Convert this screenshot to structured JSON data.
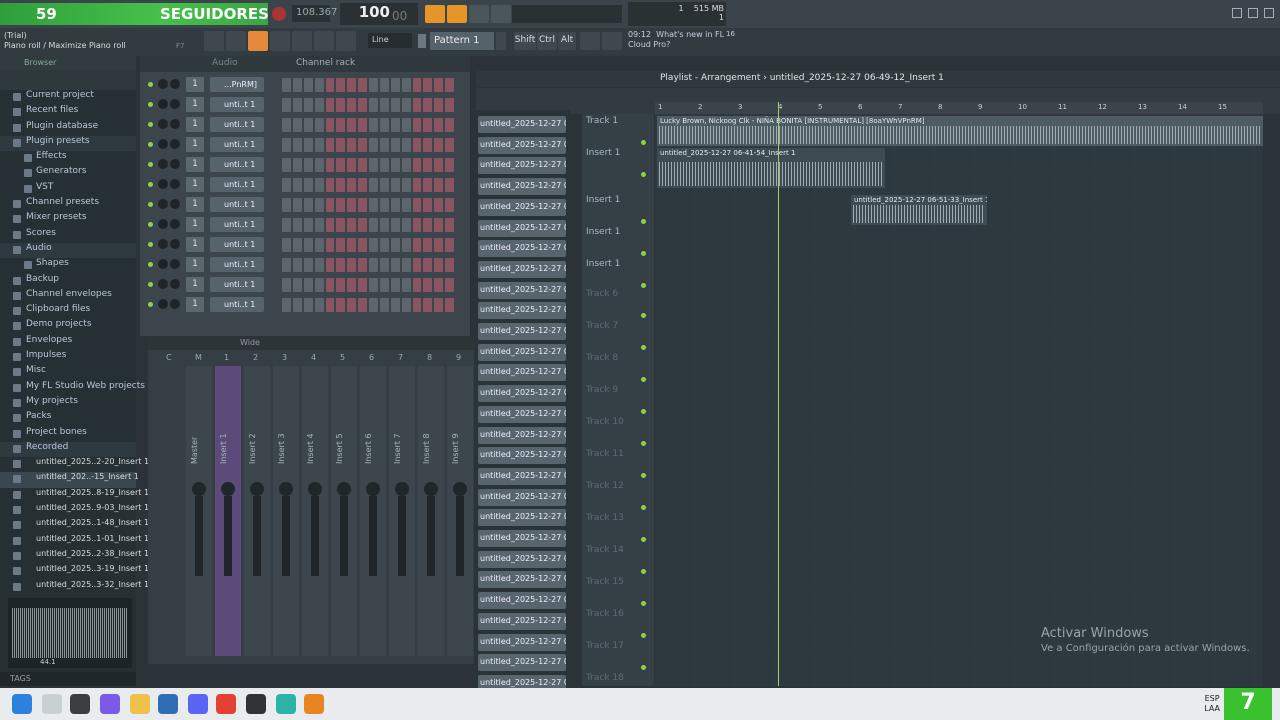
{
  "overlay": {
    "followers": "59",
    "label": "SEGUIDORES"
  },
  "transport": {
    "tempo_small": "108.367",
    "tempo": "100",
    "tempo_dec": "00",
    "memory": "515 MB",
    "cpu": "1",
    "voices": "1"
  },
  "hint": {
    "line1": "(Trial)",
    "line2": "Piano roll / Maximize Piano roll",
    "key": "F7"
  },
  "snap": "Line",
  "pattern": "Pattern 1",
  "keys": [
    "Shift",
    "Ctrl",
    "Alt"
  ],
  "news": {
    "time": "09:12",
    "line1": "What's new in FL",
    "line2": "Cloud Pro?",
    "count": "16"
  },
  "browser": {
    "title": "Browser",
    "items": [
      {
        "label": "Current project",
        "cls": ""
      },
      {
        "label": "Recent files",
        "cls": ""
      },
      {
        "label": "Plugin database",
        "cls": ""
      },
      {
        "label": "Plugin presets",
        "cls": "hl"
      },
      {
        "label": "Effects",
        "cls": "sub"
      },
      {
        "label": "Generators",
        "cls": "sub"
      },
      {
        "label": "VST",
        "cls": "sub"
      },
      {
        "label": "Channel presets",
        "cls": ""
      },
      {
        "label": "Mixer presets",
        "cls": ""
      },
      {
        "label": "Scores",
        "cls": ""
      },
      {
        "label": "Audio",
        "cls": "hl"
      },
      {
        "label": "Shapes",
        "cls": "sub"
      },
      {
        "label": "Backup",
        "cls": ""
      },
      {
        "label": "Channel envelopes",
        "cls": ""
      },
      {
        "label": "Clipboard files",
        "cls": ""
      },
      {
        "label": "Demo projects",
        "cls": ""
      },
      {
        "label": "Envelopes",
        "cls": ""
      },
      {
        "label": "Impulses",
        "cls": ""
      },
      {
        "label": "Misc",
        "cls": ""
      },
      {
        "label": "My FL Studio Web projects",
        "cls": ""
      },
      {
        "label": "My projects",
        "cls": ""
      },
      {
        "label": "Packs",
        "cls": ""
      },
      {
        "label": "Project bones",
        "cls": ""
      },
      {
        "label": "Recorded",
        "cls": "hl"
      },
      {
        "label": "untitled_2025..2-20_Insert 1",
        "cls": "rec"
      },
      {
        "label": "untitled_202..-15_Insert 1",
        "cls": "rec sel"
      },
      {
        "label": "untitled_2025..8-19_Insert 1",
        "cls": "rec"
      },
      {
        "label": "untitled_2025..9-03_Insert 1",
        "cls": "rec"
      },
      {
        "label": "untitled_2025..1-48_Insert 1",
        "cls": "rec"
      },
      {
        "label": "untitled_2025..1-01_Insert 1",
        "cls": "rec"
      },
      {
        "label": "untitled_2025..2-38_Insert 1",
        "cls": "rec"
      },
      {
        "label": "untitled_2025..3-19_Insert 1",
        "cls": "rec"
      },
      {
        "label": "untitled_2025..3-32_Insert 1",
        "cls": "rec"
      }
    ],
    "sample_info": "44.1",
    "tags": "TAGS"
  },
  "rack": {
    "filter": "Audio",
    "title": "Channel rack",
    "channels": [
      {
        "num": "1",
        "name": "...PnRM]"
      },
      {
        "num": "1",
        "name": "unti..t 1"
      },
      {
        "num": "1",
        "name": "unti..t 1"
      },
      {
        "num": "1",
        "name": "unti..t 1"
      },
      {
        "num": "1",
        "name": "unti..t 1"
      },
      {
        "num": "1",
        "name": "unti..t 1"
      },
      {
        "num": "1",
        "name": "unti..t 1"
      },
      {
        "num": "1",
        "name": "unti..t 1"
      },
      {
        "num": "1",
        "name": "unti..t 1"
      },
      {
        "num": "1",
        "name": "unti..t 1"
      },
      {
        "num": "1",
        "name": "unti..t 1"
      },
      {
        "num": "1",
        "name": "unti..t 1"
      }
    ]
  },
  "mixer": {
    "mode": "Wide",
    "cols": [
      "C",
      "M",
      "1",
      "2",
      "3",
      "4",
      "5",
      "6",
      "7",
      "8",
      "9"
    ],
    "strips": [
      "Master",
      "Insert 1",
      "Insert 2",
      "Insert 3",
      "Insert 4",
      "Insert 5",
      "Insert 6",
      "Insert 7",
      "Insert 8",
      "Insert 9"
    ]
  },
  "playlist": {
    "title": "Playlist - Arrangement",
    "sep": "›",
    "project": "untitled_2025-12-27 06-49-12_Insert 1",
    "ruler": [
      "1",
      "2",
      "3",
      "4",
      "5",
      "6",
      "7",
      "8",
      "9",
      "10",
      "11",
      "12",
      "13",
      "14",
      "15"
    ],
    "patterns": [
      "untitled_2025-12-27 06-",
      "untitled_2025-12-27 06-",
      "untitled_2025-12-27 06-",
      "untitled_2025-12-27 06-",
      "untitled_2025-12-27 06-",
      "untitled_2025-12-27 06-",
      "untitled_2025-12-27 06-",
      "untitled_2025-12-27 06-",
      "untitled_2025-12-27 06-",
      "untitled_2025-12-27 06-",
      "untitled_2025-12-27 06-",
      "untitled_2025-12-27 06-",
      "untitled_2025-12-27 06-",
      "untitled_2025-12-27 06-",
      "untitled_2025-12-27 06-",
      "untitled_2025-12-27 06-",
      "untitled_2025-12-27 06-",
      "untitled_2025-12-27 06-",
      "untitled_2025-12-27 06-",
      "untitled_2025-12-27 06-",
      "untitled_2025-12-27 06-",
      "untitled_2025-12-27 06-",
      "untitled_2025-12-27 06-",
      "untitled_2025-12-27 06-",
      "untitled_2025-12-27 06-",
      "untitled_2025-12-27 06-",
      "untitled_2025-12-27 06-",
      "untitled_2025-12-27 06-"
    ],
    "tracks": [
      "Track 1",
      "Insert 1",
      "Insert 1",
      "Insert 1",
      "Insert 1",
      "Track 6",
      "Track 7",
      "Track 8",
      "Track 9",
      "Track 10",
      "Track 11",
      "Track 12",
      "Track 13",
      "Track 14",
      "Track 15",
      "Track 16",
      "Track 17",
      "Track 18"
    ],
    "clips": [
      "Lucky Brown, Nickoog Clk - NIÑA BONITA [INSTRUMENTAL] [8oaYWhVPnRM]",
      "untitled_2025-12-27 06-41-54_Insert 1",
      "untitled_2025-12-27 06-51-33_Insert 1"
    ]
  },
  "watermark": {
    "line1": "Activar Windows",
    "line2": "Ve a Configuración para activar Windows."
  },
  "tray": {
    "lang1": "ESP",
    "lang2": "LAA",
    "badge": "7"
  }
}
